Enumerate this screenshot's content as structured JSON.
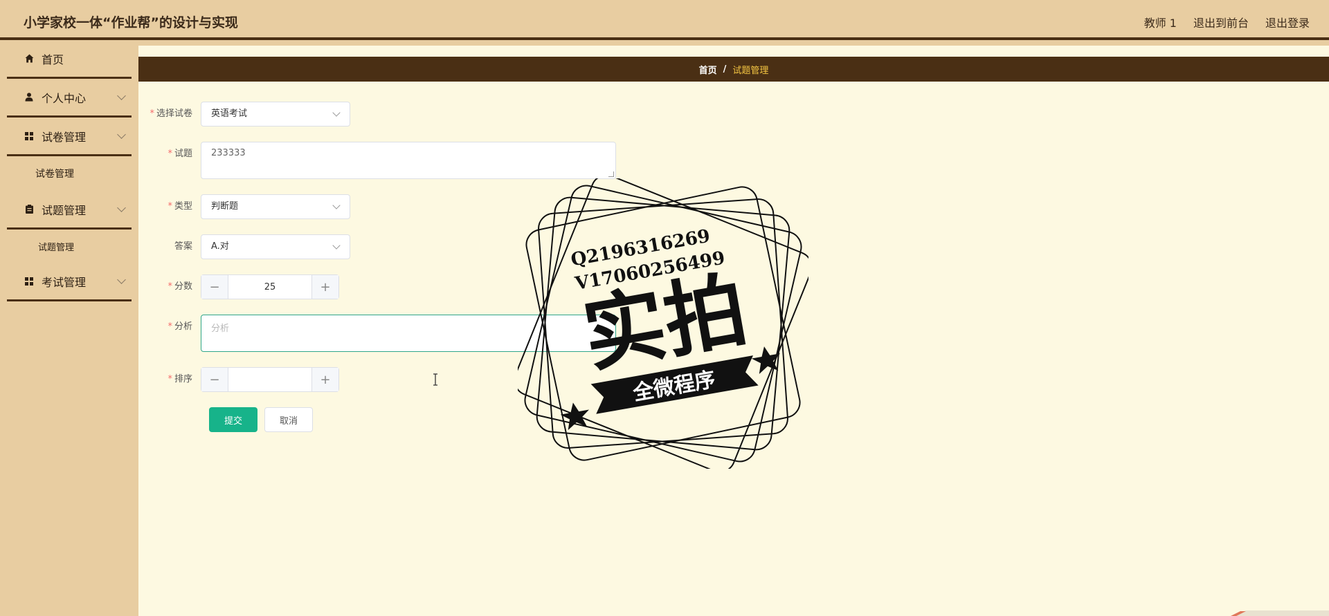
{
  "header": {
    "title": "小学家校一体“作业帮”的设计与实现",
    "links": [
      "教师 1",
      "退出到前台",
      "退出登录"
    ]
  },
  "sidebar": {
    "items": [
      {
        "label": "首页",
        "icon": "home-icon",
        "expandable": false
      },
      {
        "label": "个人中心",
        "icon": "user-icon",
        "expandable": true
      },
      {
        "label": "试卷管理",
        "icon": "grid-icon",
        "expandable": true,
        "sub": "试卷管理"
      },
      {
        "label": "试题管理",
        "icon": "clipboard-icon",
        "expandable": true,
        "sub": "试题管理"
      },
      {
        "label": "考试管理",
        "icon": "grid-icon",
        "expandable": true
      }
    ]
  },
  "breadcrumb": {
    "home": "首页",
    "separator": "/",
    "current": "试题管理"
  },
  "form": {
    "paper": {
      "label": "选择试卷",
      "value": "英语考试"
    },
    "question": {
      "label": "试题",
      "value": "233333"
    },
    "type": {
      "label": "类型",
      "value": "判断题"
    },
    "answer": {
      "label": "答案",
      "value": "A.对"
    },
    "score": {
      "label": "分数",
      "value": "25",
      "minus": "−",
      "plus": "+"
    },
    "analysis": {
      "label": "分析",
      "placeholder": "分析"
    },
    "order": {
      "label": "排序",
      "value": "",
      "minus": "−",
      "plus": "+"
    },
    "submit": "提交",
    "cancel": "取消"
  },
  "watermark": {
    "line1": "Q2196316269",
    "line2": "V17060256499",
    "big": "实拍",
    "banner": "全微程序"
  },
  "colors": {
    "accent": "#17b38a",
    "header_bg": "#e8cda1",
    "dark_brown": "#4a2f14",
    "breadcrumb_current": "#f4c542",
    "page_bg": "#fdf9e1"
  }
}
